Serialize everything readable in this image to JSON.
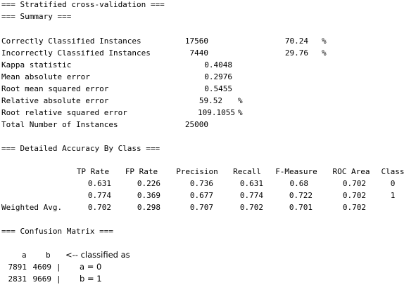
{
  "header": {
    "stratified": "=== Stratified cross-validation ===",
    "summary": "=== Summary ==="
  },
  "summary": {
    "correct": {
      "label": "Correctly Classified Instances",
      "value": "17560",
      "pct": "70.24",
      "unit": "%"
    },
    "incorrect": {
      "label": "Incorrectly Classified Instances",
      "value": "7440",
      "pct": "29.76",
      "unit": "%"
    },
    "kappa": {
      "label": "Kappa statistic",
      "value": "0.4048"
    },
    "mae": {
      "label": "Mean absolute error",
      "value": "0.2976"
    },
    "rmse": {
      "label": "Root mean squared error",
      "value": "0.5455"
    },
    "rae": {
      "label": "Relative absolute error",
      "value": "59.52",
      "unit": "%"
    },
    "rrse": {
      "label": "Root relative squared error",
      "value": "109.1055",
      "unit": "%"
    },
    "total": {
      "label": "Total Number of Instances",
      "value": "25000"
    }
  },
  "accuracy": {
    "heading": "=== Detailed Accuracy By Class ===",
    "columns": [
      "TP Rate",
      "FP Rate",
      "Precision",
      "Recall",
      "F-Measure",
      "ROC Area",
      "Class"
    ],
    "rows": [
      {
        "label": "",
        "values": [
          "0.631",
          "0.226",
          "0.736",
          "0.631",
          "0.68",
          "0.702",
          "0"
        ]
      },
      {
        "label": "",
        "values": [
          "0.774",
          "0.369",
          "0.677",
          "0.774",
          "0.722",
          "0.702",
          "1"
        ]
      },
      {
        "label": "Weighted Avg.",
        "values": [
          "0.702",
          "0.298",
          "0.707",
          "0.702",
          "0.701",
          "0.702"
        ]
      }
    ]
  },
  "confusion": {
    "heading": "=== Confusion Matrix ===",
    "col_a": "a",
    "col_b": "b",
    "classified_as": "<-- classified as",
    "rows": [
      {
        "a": "7891",
        "b": "4609",
        "sep": "|",
        "assign": "a = 0"
      },
      {
        "a": "2831",
        "b": "9669",
        "sep": "|",
        "assign": "b = 1"
      }
    ]
  }
}
